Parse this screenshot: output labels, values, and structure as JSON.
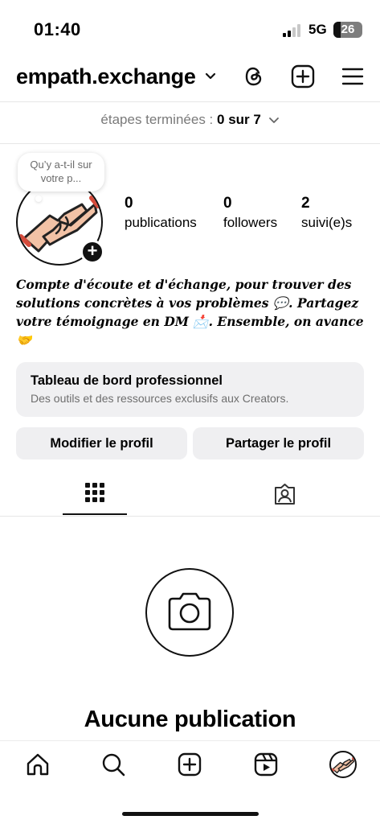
{
  "status_bar": {
    "time": "01:40",
    "network": "5G",
    "battery": "26",
    "battery_level": 0.26
  },
  "header": {
    "username": "empath.exchange"
  },
  "steps": {
    "label": "étapes terminées :",
    "value": "0 sur 7"
  },
  "profile": {
    "note": "Qu’y a-t-il sur votre p...",
    "stats": [
      {
        "count": "0",
        "label": "publications"
      },
      {
        "count": "0",
        "label": "followers"
      },
      {
        "count": "2",
        "label": "suivi(e)s"
      }
    ],
    "bio": "Compte d'écoute et d'échange, pour trouver des solutions concrètes à vos problèmes 💬. Partagez votre témoignage en DM 📩. Ensemble, on avance 🤝"
  },
  "pro_dashboard": {
    "title": "Tableau de bord professionnel",
    "subtitle": "Des outils et des ressources exclusifs aux Creators."
  },
  "buttons": {
    "edit": "Modifier le profil",
    "share": "Partager le profil"
  },
  "empty_state": {
    "title": "Aucune publication"
  },
  "icons": {
    "header": [
      "threads-icon",
      "add-post-icon",
      "menu-icon"
    ],
    "tabs": [
      "grid-icon",
      "tagged-icon"
    ],
    "nav": [
      "home-icon",
      "search-icon",
      "create-icon",
      "reels-icon",
      "profile-avatar"
    ]
  }
}
